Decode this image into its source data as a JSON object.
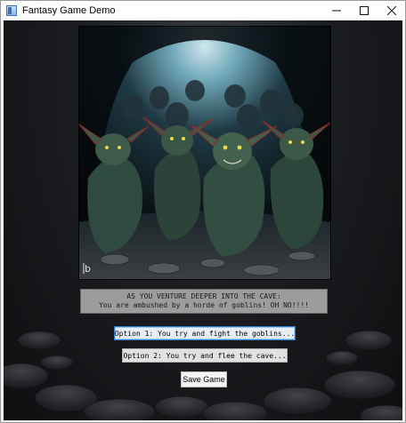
{
  "window": {
    "title": "Fantasy Game Demo",
    "icon": "app-window-icon"
  },
  "scene": {
    "description_icon": "goblin-horde-image",
    "signature": "b"
  },
  "dialog": {
    "line1": "AS YOU VENTURE DEEPER INTO THE CAVE:",
    "line2": "You are ambushed by a horde of goblins! OH NO!!!!"
  },
  "options": [
    {
      "label": "Option 1: You try and fight the goblins..."
    },
    {
      "label": "Option 2: You try and flee the cave..."
    }
  ],
  "save_button": {
    "label": "Save Game"
  },
  "colors": {
    "dialog_bg": "#9c9c9c",
    "focus": "#2e7bd1",
    "goblin_skin": "#3d5a4a",
    "goblin_eye": "#e6d84a"
  }
}
